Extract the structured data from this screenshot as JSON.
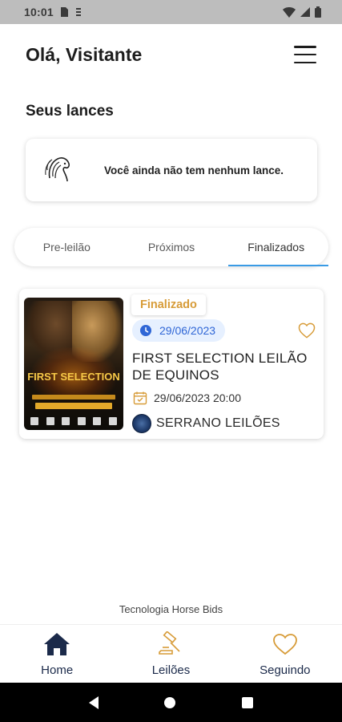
{
  "status_bar": {
    "time": "10:01",
    "icons": [
      "sim-card-icon",
      "storage-icon",
      "wifi-icon",
      "signal-icon",
      "battery-icon"
    ]
  },
  "header": {
    "greeting": "Olá, Visitante",
    "menu_icon": "hamburger-menu-icon"
  },
  "bids": {
    "section_title": "Seus lances",
    "empty_message": "Você ainda não tem nenhum lance.",
    "empty_icon": "horse-head-logo"
  },
  "tabs": [
    {
      "label": "Pre-leilão",
      "active": false
    },
    {
      "label": "Próximos",
      "active": false
    },
    {
      "label": "Finalizados",
      "active": true
    }
  ],
  "auction_card": {
    "status_badge": "Finalizado",
    "badge_color": "#d79b37",
    "date": "29/06/2023",
    "title": "FIRST SELECTION LEILÃO DE EQUINOS",
    "datetime": "29/06/2023 20:00",
    "auctioneer": "SERRANO LEILÕES",
    "poster_title": "FIRST SELECTION"
  },
  "footer": {
    "tech_text": "Tecnologia Horse Bids"
  },
  "bottom_nav": [
    {
      "label": "Home",
      "icon": "home-icon",
      "active": true
    },
    {
      "label": "Leilões",
      "icon": "gavel-icon",
      "active": false
    },
    {
      "label": "Seguindo",
      "icon": "heart-icon",
      "active": false
    }
  ],
  "colors": {
    "accent_blue": "#3a9be5",
    "date_pill_bg": "#e6f0ff",
    "date_pill_text": "#2f66d6",
    "gold": "#d79b37",
    "nav_dark": "#1b2a4a"
  }
}
